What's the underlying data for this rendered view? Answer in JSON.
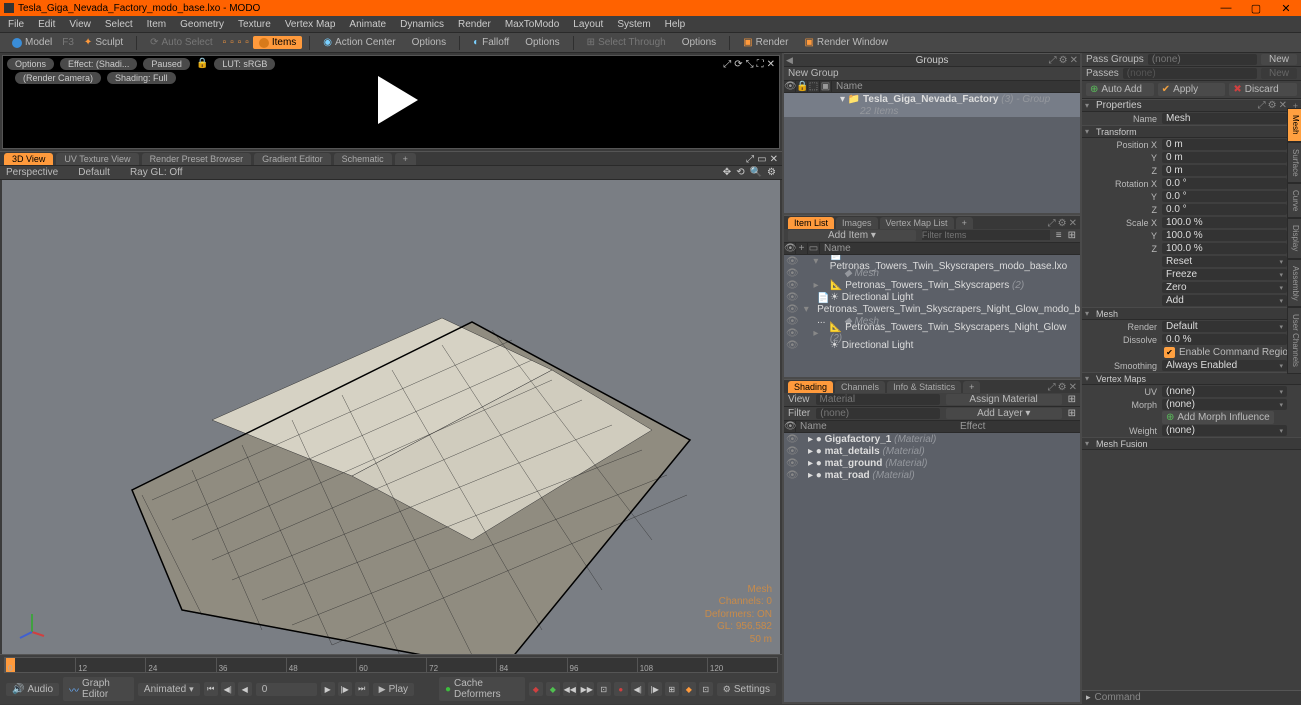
{
  "title": "Tesla_Giga_Nevada_Factory_modo_base.lxo - MODO",
  "menubar": [
    "File",
    "Edit",
    "View",
    "Select",
    "Item",
    "Geometry",
    "Texture",
    "Vertex Map",
    "Animate",
    "Dynamics",
    "Render",
    "MaxToModo",
    "Layout",
    "System",
    "Help"
  ],
  "toolbar": {
    "model": "Model",
    "f1": "F3",
    "sculpt": "Sculpt",
    "auto_select": "Auto Select",
    "items": "Items",
    "action_center": "Action Center",
    "options": "Options",
    "falloff": "Falloff",
    "options2": "Options",
    "select_through": "Select Through",
    "options3": "Options",
    "render": "Render",
    "render_window": "Render Window"
  },
  "preview": {
    "options": "Options",
    "effect": "Effect: (Shadi...",
    "paused": "Paused",
    "lut": "LUT: sRGB",
    "camera": "(Render Camera)",
    "shading": "Shading: Full"
  },
  "view_tabs": [
    "3D View",
    "UV Texture View",
    "Render Preset Browser",
    "Gradient Editor",
    "Schematic"
  ],
  "viewport_bar": {
    "persp": "Perspective",
    "default": "Default",
    "raygl": "Ray GL: Off"
  },
  "viewport_info": {
    "l1": "Mesh",
    "l2": "Channels: 0",
    "l3": "Deformers: ON",
    "l4": "GL: 956,582",
    "l5": "50 m"
  },
  "timeline": {
    "ticks": [
      "0",
      "12",
      "24",
      "36",
      "48",
      "60",
      "72",
      "84",
      "96",
      "108",
      "120"
    ],
    "audio": "Audio",
    "graph": "Graph Editor",
    "animated": "Animated",
    "frame": "0",
    "play": "Play",
    "cache": "Cache Deformers",
    "settings": "Settings"
  },
  "groups": {
    "title": "Groups",
    "new_group": "New Group",
    "name_hdr": "Name",
    "item_name": "Tesla_Giga_Nevada_Factory",
    "item_suffix": "(3)",
    "item_type": "- Group",
    "item_count": "22 Items"
  },
  "item_list": {
    "tabs": [
      "Item List",
      "Images",
      "Vertex Map List"
    ],
    "add": "Add Item",
    "filter": "Filter Items",
    "name_hdr": "Name",
    "rows": [
      {
        "indent": 0,
        "exp": "▾",
        "icon": "📄",
        "text": "Petronas_Towers_Twin_Skyscrapers_modo_base.lxo"
      },
      {
        "indent": 1,
        "exp": "",
        "icon": "◆",
        "text": "Mesh",
        "dim": true
      },
      {
        "indent": 0,
        "exp": "▸",
        "icon": "📐",
        "text": "Petronas_Towers_Twin_Skyscrapers",
        "suffix": "(2)"
      },
      {
        "indent": 0,
        "exp": "",
        "icon": "☀",
        "text": "Directional Light"
      },
      {
        "indent": 0,
        "exp": "▾",
        "icon": "📄",
        "text": "Petronas_Towers_Twin_Skyscrapers_Night_Glow_modo_b ..."
      },
      {
        "indent": 1,
        "exp": "",
        "icon": "◆",
        "text": "Mesh",
        "dim": true
      },
      {
        "indent": 0,
        "exp": "▸",
        "icon": "📐",
        "text": "Petronas_Towers_Twin_Skyscrapers_Night_Glow",
        "suffix": "(2)"
      },
      {
        "indent": 0,
        "exp": "",
        "icon": "☀",
        "text": "Directional Light"
      }
    ]
  },
  "shading": {
    "tabs": [
      "Shading",
      "Channels",
      "Info & Statistics"
    ],
    "view": "View",
    "material": "Material",
    "assign": "Assign Material",
    "filter": "Filter",
    "none": "(none)",
    "add_layer": "Add Layer",
    "name_hdr": "Name",
    "effect_hdr": "Effect",
    "rows": [
      {
        "name": "Gigafactory_1",
        "type": "(Material)"
      },
      {
        "name": "mat_details",
        "type": "(Material)"
      },
      {
        "name": "mat_ground",
        "type": "(Material)"
      },
      {
        "name": "mat_road",
        "type": "(Material)"
      }
    ]
  },
  "props": {
    "pass_groups": "Pass Groups",
    "none": "(none)",
    "new": "New",
    "passes": "Passes",
    "auto_add": "Auto Add",
    "apply": "Apply",
    "discard": "Discard",
    "properties": "Properties",
    "name_label": "Name",
    "name_val": "Mesh",
    "transform": "Transform",
    "pos": "Position X",
    "posx": "0 m",
    "posy": "0 m",
    "posz": "0 m",
    "rot": "Rotation X",
    "rotx": "0.0 °",
    "roty": "0.0 °",
    "rotz": "0.0 °",
    "scale": "Scale X",
    "sx": "100.0 %",
    "sy": "100.0 %",
    "sz": "100.0 %",
    "y": "Y",
    "z": "Z",
    "reset": "Reset",
    "freeze": "Freeze",
    "zero": "Zero",
    "add": "Add",
    "mesh": "Mesh",
    "render": "Render",
    "default": "Default",
    "dissolve": "Dissolve",
    "dissolve_v": "0.0 %",
    "enable_cmd": "Enable Command Regions",
    "smoothing": "Smoothing",
    "always": "Always Enabled",
    "vmaps": "Vertex Maps",
    "uv": "UV",
    "morph": "Morph",
    "add_morph": "Add Morph Influence",
    "weight": "Weight",
    "mesh_fusion": "Mesh Fusion",
    "command": "Command"
  },
  "side_tabs": [
    "Mesh",
    "Surface",
    "Curve",
    "Display",
    "Assembly",
    "User Channels"
  ]
}
